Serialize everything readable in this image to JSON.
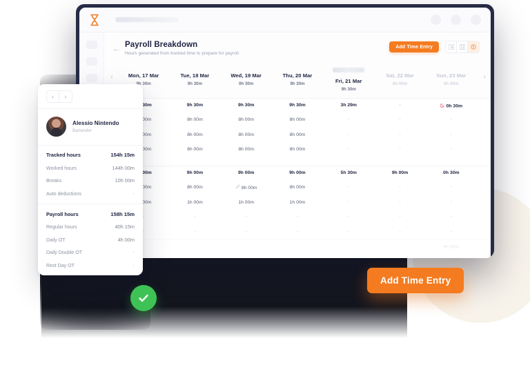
{
  "browser": {
    "logo_icon": "hourglass-icon",
    "url_placeholder": "",
    "window_dots": 3
  },
  "sidebar": {
    "placeholder_items": 4
  },
  "header": {
    "back_icon": "arrow-left-icon",
    "title": "Payroll Breakdown",
    "subtitle": "Hours generated from tracked time to prepare for payroll",
    "cta_label": "Add Time Entry",
    "view_toggles": [
      {
        "name": "list-view",
        "icon": "list-icon",
        "active": false
      },
      {
        "name": "column-view",
        "icon": "columns-icon",
        "active": false
      },
      {
        "name": "payroll-view",
        "icon": "payroll-icon",
        "active": true
      }
    ]
  },
  "date_nav": {
    "prev_icon": "chevron-left-icon",
    "next_icon": "chevron-right-icon",
    "columns": [
      {
        "label": "Mon, 17 Mar",
        "hours": "9h 30m",
        "muted": false,
        "badge": false
      },
      {
        "label": "Tue, 18 Mar",
        "hours": "9h 30m",
        "muted": false,
        "badge": false
      },
      {
        "label": "Wed, 19 Mar",
        "hours": "9h 30m",
        "muted": false,
        "badge": false
      },
      {
        "label": "Thu, 20 Mar",
        "hours": "9h 30m",
        "muted": false,
        "badge": false
      },
      {
        "label": "Fri, 21 Mar",
        "hours": "9h 30m",
        "muted": false,
        "badge": true
      },
      {
        "label": "Sat, 22 Mar",
        "hours": "0h 00m",
        "muted": true,
        "badge": false
      },
      {
        "label": "Sun, 23 Mar",
        "hours": "0h 00m",
        "muted": true,
        "badge": false
      }
    ]
  },
  "table": {
    "rows": [
      {
        "type": "data",
        "strong": true,
        "sep": true,
        "cells": [
          "9h 30m",
          "9h 30m",
          "9h 30m",
          "9h 30m",
          "3h 29m",
          "-",
          "0h 30m"
        ],
        "icons": {
          "6": "moon-icon"
        }
      },
      {
        "type": "data",
        "strong": false,
        "sep": false,
        "cells": [
          "8h 00m",
          "8h 00m",
          "8h 00m",
          "8h 00m",
          "-",
          "-",
          "-"
        ]
      },
      {
        "type": "data",
        "strong": false,
        "sep": false,
        "cells": [
          "8h 00m",
          "8h 00m",
          "8h 00m",
          "8h 00m",
          "-",
          "-",
          "-"
        ]
      },
      {
        "type": "data",
        "strong": false,
        "sep": false,
        "cells": [
          "8h 00m",
          "8h 00m",
          "8h 00m",
          "8h 00m",
          "-",
          "-",
          "-"
        ]
      },
      {
        "type": "spacer"
      },
      {
        "type": "data",
        "strong": true,
        "sep": true,
        "cells": [
          "9h 00m",
          "9h 00m",
          "9h 00m",
          "9h 00m",
          "5h 30m",
          "9h 00m",
          "0h 30m"
        ]
      },
      {
        "type": "data",
        "strong": false,
        "sep": false,
        "cells": [
          "8h 00m",
          "8h 00m",
          "8h 00m",
          "8h 00m",
          "-",
          "-",
          "-"
        ],
        "icons": {
          "2": "pencil-icon"
        }
      },
      {
        "type": "data",
        "strong": false,
        "sep": false,
        "cells": [
          "1h 00m",
          "1h 00m",
          "1h 00m",
          "1h 00m",
          "-",
          "-",
          "-"
        ]
      },
      {
        "type": "data",
        "strong": false,
        "sep": false,
        "cells": [
          "-",
          "-",
          "-",
          "-",
          "-",
          "-",
          "-"
        ]
      },
      {
        "type": "data",
        "strong": false,
        "sep": false,
        "cells": [
          "-",
          "-",
          "-",
          "-",
          "-",
          "-",
          "-"
        ]
      },
      {
        "type": "data",
        "strong": false,
        "sep": true,
        "cells": [
          "-",
          "-",
          "-",
          "-",
          "-",
          "-",
          "0h 30m"
        ]
      }
    ]
  },
  "employee_card": {
    "prev_icon": "chevron-left-icon",
    "next_icon": "chevron-right-icon",
    "avatar_icon": "avatar",
    "name": "Alessio Nintendo",
    "role": "Bartender",
    "tracked_group": [
      {
        "label": "Tracked hours",
        "value": "154h 15m",
        "head": true
      },
      {
        "label": "Worked hours",
        "value": "144h 00m",
        "head": false
      },
      {
        "label": "Breaks",
        "value": "10h 00m",
        "head": false
      },
      {
        "label": "Auto deductions",
        "value": "-",
        "head": false
      }
    ],
    "payroll_group": [
      {
        "label": "Payroll hours",
        "value": "158h 15m",
        "head": true
      },
      {
        "label": "Regular hours",
        "value": "40h 15m",
        "head": false
      },
      {
        "label": "Daily OT",
        "value": "4h 00m",
        "head": false
      },
      {
        "label": "Daily Double OT",
        "value": "-",
        "head": false
      },
      {
        "label": "Rest Day OT",
        "value": "-",
        "head": false
      }
    ]
  },
  "badges": {
    "success_icon": "check-icon"
  },
  "cta": {
    "label": "Add Time Entry"
  },
  "colors": {
    "accent_orange": "#f47b20",
    "dark_navy": "#262b46",
    "success_green": "#3fc255",
    "night_pink": "#ec6a7f",
    "cream": "#f7f2ea"
  }
}
